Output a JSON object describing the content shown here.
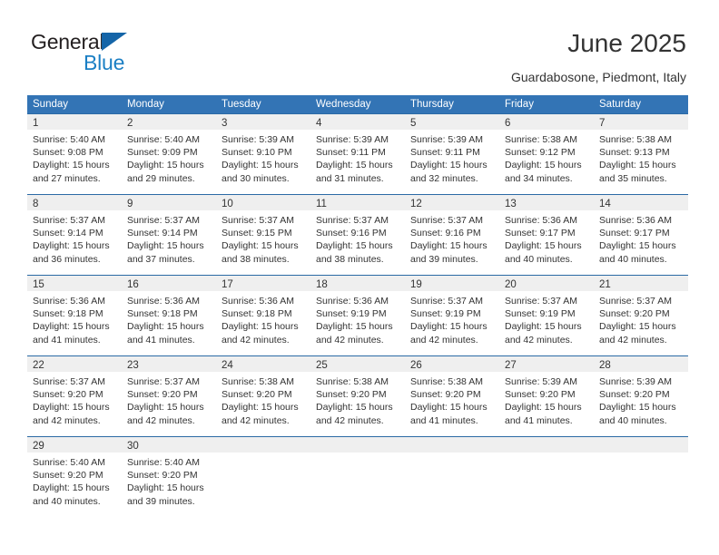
{
  "brand": {
    "name_part1": "General",
    "name_part2": "Blue",
    "accent_color": "#1b7fc4",
    "triangle_color": "#1565a8"
  },
  "header": {
    "title": "June 2025",
    "subtitle": "Guardabosone, Piedmont, Italy"
  },
  "calendar": {
    "header_bg": "#3374b5",
    "weekdays": [
      "Sunday",
      "Monday",
      "Tuesday",
      "Wednesday",
      "Thursday",
      "Friday",
      "Saturday"
    ],
    "weeks": [
      [
        {
          "day": "1",
          "sunrise": "Sunrise: 5:40 AM",
          "sunset": "Sunset: 9:08 PM",
          "daylight1": "Daylight: 15 hours",
          "daylight2": "and 27 minutes."
        },
        {
          "day": "2",
          "sunrise": "Sunrise: 5:40 AM",
          "sunset": "Sunset: 9:09 PM",
          "daylight1": "Daylight: 15 hours",
          "daylight2": "and 29 minutes."
        },
        {
          "day": "3",
          "sunrise": "Sunrise: 5:39 AM",
          "sunset": "Sunset: 9:10 PM",
          "daylight1": "Daylight: 15 hours",
          "daylight2": "and 30 minutes."
        },
        {
          "day": "4",
          "sunrise": "Sunrise: 5:39 AM",
          "sunset": "Sunset: 9:11 PM",
          "daylight1": "Daylight: 15 hours",
          "daylight2": "and 31 minutes."
        },
        {
          "day": "5",
          "sunrise": "Sunrise: 5:39 AM",
          "sunset": "Sunset: 9:11 PM",
          "daylight1": "Daylight: 15 hours",
          "daylight2": "and 32 minutes."
        },
        {
          "day": "6",
          "sunrise": "Sunrise: 5:38 AM",
          "sunset": "Sunset: 9:12 PM",
          "daylight1": "Daylight: 15 hours",
          "daylight2": "and 34 minutes."
        },
        {
          "day": "7",
          "sunrise": "Sunrise: 5:38 AM",
          "sunset": "Sunset: 9:13 PM",
          "daylight1": "Daylight: 15 hours",
          "daylight2": "and 35 minutes."
        }
      ],
      [
        {
          "day": "8",
          "sunrise": "Sunrise: 5:37 AM",
          "sunset": "Sunset: 9:14 PM",
          "daylight1": "Daylight: 15 hours",
          "daylight2": "and 36 minutes."
        },
        {
          "day": "9",
          "sunrise": "Sunrise: 5:37 AM",
          "sunset": "Sunset: 9:14 PM",
          "daylight1": "Daylight: 15 hours",
          "daylight2": "and 37 minutes."
        },
        {
          "day": "10",
          "sunrise": "Sunrise: 5:37 AM",
          "sunset": "Sunset: 9:15 PM",
          "daylight1": "Daylight: 15 hours",
          "daylight2": "and 38 minutes."
        },
        {
          "day": "11",
          "sunrise": "Sunrise: 5:37 AM",
          "sunset": "Sunset: 9:16 PM",
          "daylight1": "Daylight: 15 hours",
          "daylight2": "and 38 minutes."
        },
        {
          "day": "12",
          "sunrise": "Sunrise: 5:37 AM",
          "sunset": "Sunset: 9:16 PM",
          "daylight1": "Daylight: 15 hours",
          "daylight2": "and 39 minutes."
        },
        {
          "day": "13",
          "sunrise": "Sunrise: 5:36 AM",
          "sunset": "Sunset: 9:17 PM",
          "daylight1": "Daylight: 15 hours",
          "daylight2": "and 40 minutes."
        },
        {
          "day": "14",
          "sunrise": "Sunrise: 5:36 AM",
          "sunset": "Sunset: 9:17 PM",
          "daylight1": "Daylight: 15 hours",
          "daylight2": "and 40 minutes."
        }
      ],
      [
        {
          "day": "15",
          "sunrise": "Sunrise: 5:36 AM",
          "sunset": "Sunset: 9:18 PM",
          "daylight1": "Daylight: 15 hours",
          "daylight2": "and 41 minutes."
        },
        {
          "day": "16",
          "sunrise": "Sunrise: 5:36 AM",
          "sunset": "Sunset: 9:18 PM",
          "daylight1": "Daylight: 15 hours",
          "daylight2": "and 41 minutes."
        },
        {
          "day": "17",
          "sunrise": "Sunrise: 5:36 AM",
          "sunset": "Sunset: 9:18 PM",
          "daylight1": "Daylight: 15 hours",
          "daylight2": "and 42 minutes."
        },
        {
          "day": "18",
          "sunrise": "Sunrise: 5:36 AM",
          "sunset": "Sunset: 9:19 PM",
          "daylight1": "Daylight: 15 hours",
          "daylight2": "and 42 minutes."
        },
        {
          "day": "19",
          "sunrise": "Sunrise: 5:37 AM",
          "sunset": "Sunset: 9:19 PM",
          "daylight1": "Daylight: 15 hours",
          "daylight2": "and 42 minutes."
        },
        {
          "day": "20",
          "sunrise": "Sunrise: 5:37 AM",
          "sunset": "Sunset: 9:19 PM",
          "daylight1": "Daylight: 15 hours",
          "daylight2": "and 42 minutes."
        },
        {
          "day": "21",
          "sunrise": "Sunrise: 5:37 AM",
          "sunset": "Sunset: 9:20 PM",
          "daylight1": "Daylight: 15 hours",
          "daylight2": "and 42 minutes."
        }
      ],
      [
        {
          "day": "22",
          "sunrise": "Sunrise: 5:37 AM",
          "sunset": "Sunset: 9:20 PM",
          "daylight1": "Daylight: 15 hours",
          "daylight2": "and 42 minutes."
        },
        {
          "day": "23",
          "sunrise": "Sunrise: 5:37 AM",
          "sunset": "Sunset: 9:20 PM",
          "daylight1": "Daylight: 15 hours",
          "daylight2": "and 42 minutes."
        },
        {
          "day": "24",
          "sunrise": "Sunrise: 5:38 AM",
          "sunset": "Sunset: 9:20 PM",
          "daylight1": "Daylight: 15 hours",
          "daylight2": "and 42 minutes."
        },
        {
          "day": "25",
          "sunrise": "Sunrise: 5:38 AM",
          "sunset": "Sunset: 9:20 PM",
          "daylight1": "Daylight: 15 hours",
          "daylight2": "and 42 minutes."
        },
        {
          "day": "26",
          "sunrise": "Sunrise: 5:38 AM",
          "sunset": "Sunset: 9:20 PM",
          "daylight1": "Daylight: 15 hours",
          "daylight2": "and 41 minutes."
        },
        {
          "day": "27",
          "sunrise": "Sunrise: 5:39 AM",
          "sunset": "Sunset: 9:20 PM",
          "daylight1": "Daylight: 15 hours",
          "daylight2": "and 41 minutes."
        },
        {
          "day": "28",
          "sunrise": "Sunrise: 5:39 AM",
          "sunset": "Sunset: 9:20 PM",
          "daylight1": "Daylight: 15 hours",
          "daylight2": "and 40 minutes."
        }
      ],
      [
        {
          "day": "29",
          "sunrise": "Sunrise: 5:40 AM",
          "sunset": "Sunset: 9:20 PM",
          "daylight1": "Daylight: 15 hours",
          "daylight2": "and 40 minutes."
        },
        {
          "day": "30",
          "sunrise": "Sunrise: 5:40 AM",
          "sunset": "Sunset: 9:20 PM",
          "daylight1": "Daylight: 15 hours",
          "daylight2": "and 39 minutes."
        },
        {
          "day": "",
          "sunrise": "",
          "sunset": "",
          "daylight1": "",
          "daylight2": ""
        },
        {
          "day": "",
          "sunrise": "",
          "sunset": "",
          "daylight1": "",
          "daylight2": ""
        },
        {
          "day": "",
          "sunrise": "",
          "sunset": "",
          "daylight1": "",
          "daylight2": ""
        },
        {
          "day": "",
          "sunrise": "",
          "sunset": "",
          "daylight1": "",
          "daylight2": ""
        },
        {
          "day": "",
          "sunrise": "",
          "sunset": "",
          "daylight1": "",
          "daylight2": ""
        }
      ]
    ]
  }
}
